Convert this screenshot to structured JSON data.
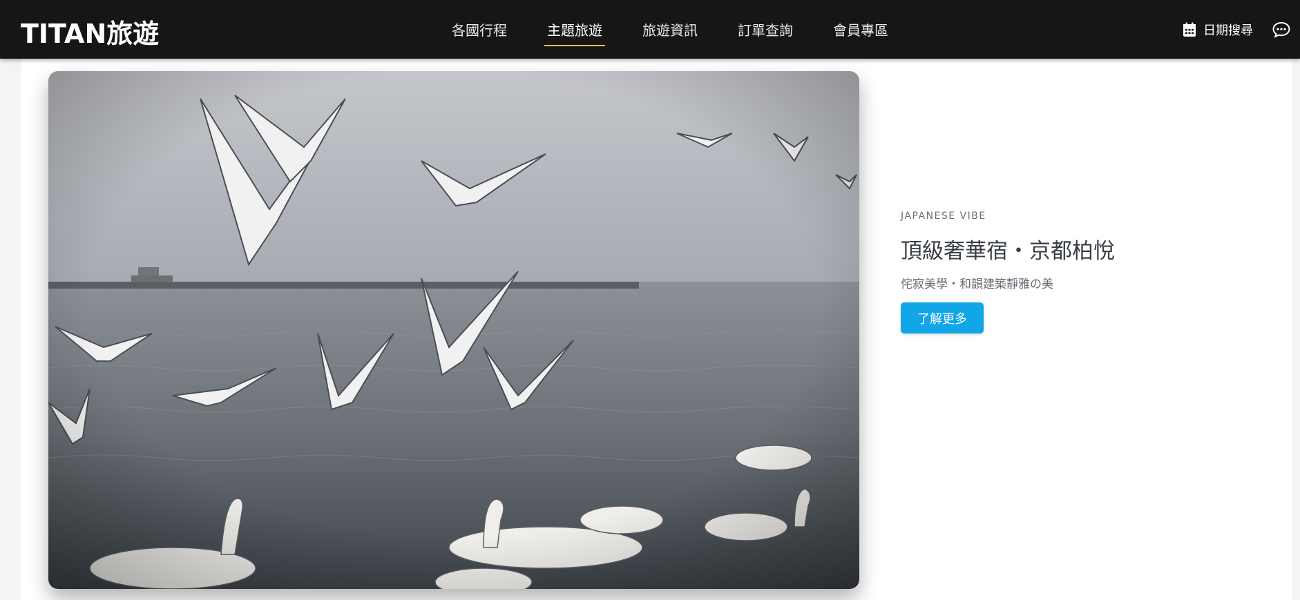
{
  "brand": {
    "name": "TITAN旅遊"
  },
  "nav": {
    "items": [
      {
        "label": "各國行程"
      },
      {
        "label": "主題旅遊"
      },
      {
        "label": "旅遊資訊"
      },
      {
        "label": "訂單查詢"
      },
      {
        "label": "會員專區"
      }
    ],
    "active_index": 1
  },
  "actions": {
    "date_search_label": "日期搜尋",
    "date_search_icon": "calendar-icon",
    "chat_icon": "chat-bubble-icon"
  },
  "feature": {
    "eyebrow": "JAPANESE VIBE",
    "title": "頂級奢華宿・京都柏悅",
    "subtitle": "侘寂美學・和韻建築靜雅の美",
    "cta_label": "了解更多"
  },
  "colors": {
    "navbar_bg": "#161616",
    "active_underline": "#f2c14e",
    "cta_bg": "#10a6e8"
  }
}
